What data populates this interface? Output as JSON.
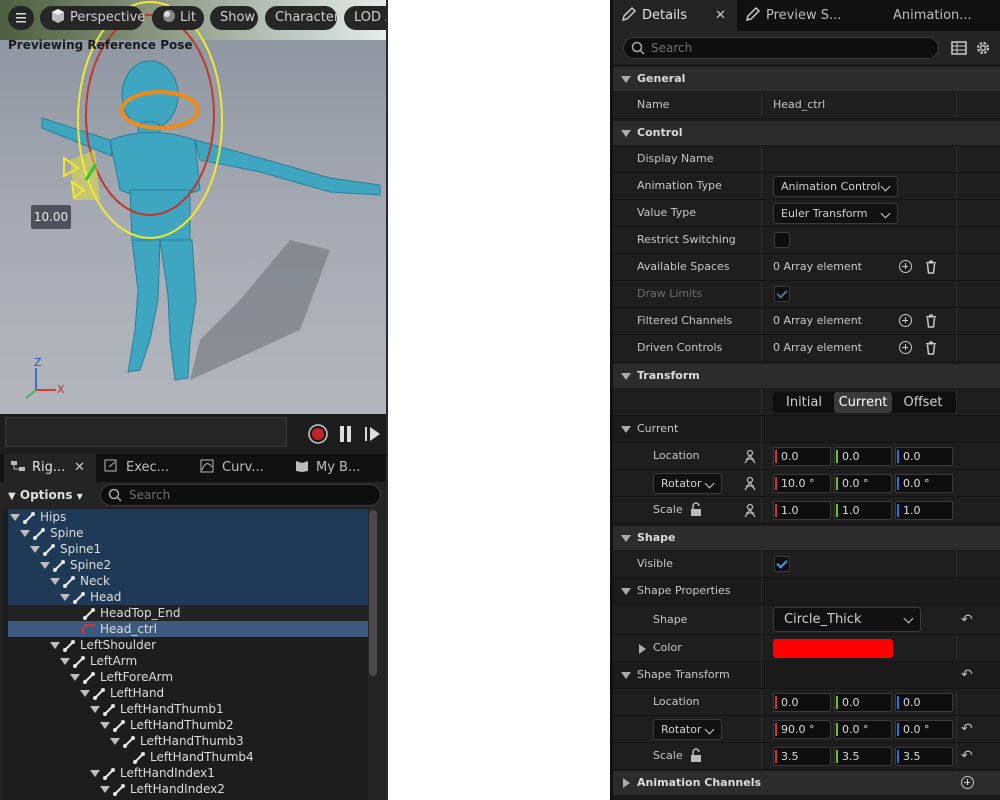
{
  "viewport": {
    "menu_label": "",
    "perspective": "Perspective",
    "lit": "Lit",
    "show": "Show",
    "character": "Character",
    "lod": "LOD A",
    "title": "Previewing Reference Pose",
    "value_box": "10.00",
    "axis_z": "Z",
    "axis_x": "X"
  },
  "left_tabs": [
    {
      "label": "Rig..."
    },
    {
      "label": "Exec..."
    },
    {
      "label": "Curv..."
    },
    {
      "label": "My B..."
    }
  ],
  "hierarchy": {
    "options_label": "Options",
    "search_placeholder": "Search",
    "rows": [
      {
        "label": "Hips"
      },
      {
        "label": "Spine"
      },
      {
        "label": "Spine1"
      },
      {
        "label": "Spine2"
      },
      {
        "label": "Neck"
      },
      {
        "label": "Head"
      },
      {
        "label": "HeadTop_End"
      },
      {
        "label": "Head_ctrl"
      },
      {
        "label": "LeftShoulder"
      },
      {
        "label": "LeftArm"
      },
      {
        "label": "LeftForeArm"
      },
      {
        "label": "LeftHand"
      },
      {
        "label": "LeftHandThumb1"
      },
      {
        "label": "LeftHandThumb2"
      },
      {
        "label": "LeftHandThumb3"
      },
      {
        "label": "LeftHandThumb4"
      },
      {
        "label": "LeftHandIndex1"
      },
      {
        "label": "LeftHandIndex2"
      }
    ]
  },
  "right_tabs": [
    {
      "label": "Details"
    },
    {
      "label": "Preview S..."
    },
    {
      "label": "Animation..."
    }
  ],
  "details": {
    "search_placeholder": "Search",
    "sections": {
      "general": "General",
      "control": "Control",
      "transform": "Transform",
      "current": "Current",
      "shape": "Shape",
      "shape_properties": "Shape Properties",
      "shape_transform": "Shape Transform",
      "animation_channels": "Animation Channels"
    },
    "name_label": "Name",
    "name_value": "Head_ctrl",
    "display_name_label": "Display Name",
    "animation_type_label": "Animation Type",
    "animation_type_value": "Animation Control",
    "value_type_label": "Value Type",
    "value_type_value": "Euler Transform",
    "restrict_switching_label": "Restrict Switching",
    "available_spaces_label": "Available Spaces",
    "available_spaces_value": "0 Array element",
    "draw_limits_label": "Draw Limits",
    "filtered_channels_label": "Filtered Channels",
    "filtered_channels_value": "0 Array element",
    "driven_controls_label": "Driven Controls",
    "driven_controls_value": "0 Array element",
    "transform_modes": [
      "Initial",
      "Current",
      "Offset"
    ],
    "location_label": "Location",
    "rotator_label": "Rotator",
    "scale_label": "Scale",
    "current_location": [
      "0.0",
      "0.0",
      "0.0"
    ],
    "current_rotator": [
      "10.0 °",
      "0.0 °",
      "0.0 °"
    ],
    "current_scale": [
      "1.0",
      "1.0",
      "1.0"
    ],
    "visible_label": "Visible",
    "shape_label": "Shape",
    "shape_value": "Circle_Thick",
    "color_label": "Color",
    "color_value": "#ff0000",
    "shape_location": [
      "0.0",
      "0.0",
      "0.0"
    ],
    "shape_rotator": [
      "90.0 °",
      "0.0 °",
      "0.0 °"
    ],
    "shape_scale": [
      "3.5",
      "3.5",
      "3.5"
    ]
  }
}
